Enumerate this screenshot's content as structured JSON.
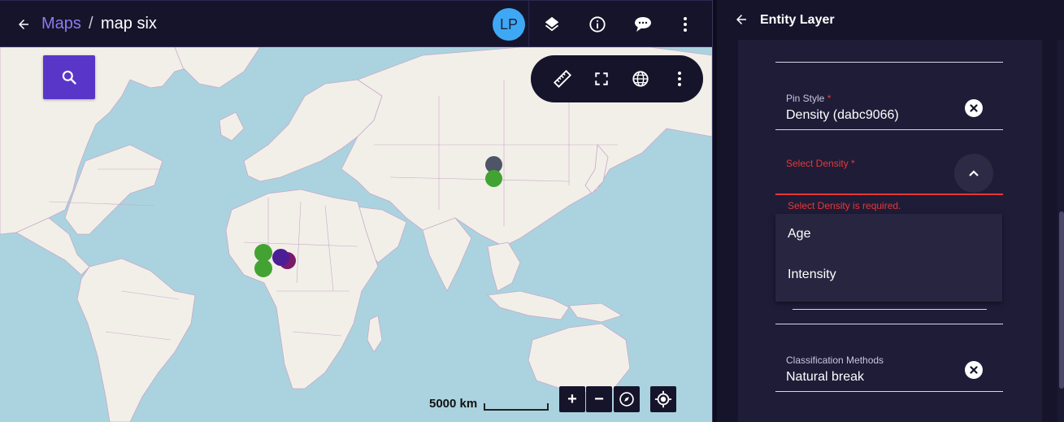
{
  "header": {
    "breadcrumb_root": "Maps",
    "breadcrumb_sep": "/",
    "title": "map six",
    "avatar_initials": "LP",
    "avatar_color": "#3ea8f5"
  },
  "map": {
    "scale_label": "5000 km",
    "zoom_in_label": "+",
    "zoom_out_label": "−",
    "pin_colors": {
      "green": "#43a332",
      "indigo": "#4b1e96",
      "purple": "#7a1a6b",
      "slate": "#4d5566"
    }
  },
  "panel": {
    "title": "Entity Layer",
    "pin_style": {
      "label": "Pin Style",
      "required_mark": "*",
      "value": "Density (dabc9066)"
    },
    "select_density": {
      "label": "Select Density",
      "required_mark": "*",
      "error": "Select Density is required.",
      "options": [
        "Age",
        "Intensity"
      ]
    },
    "classification": {
      "label": "Classification Methods",
      "value": "Natural break"
    }
  },
  "colors": {
    "accent": "#5a36c8",
    "error": "#e53935",
    "background": "#16142b"
  }
}
